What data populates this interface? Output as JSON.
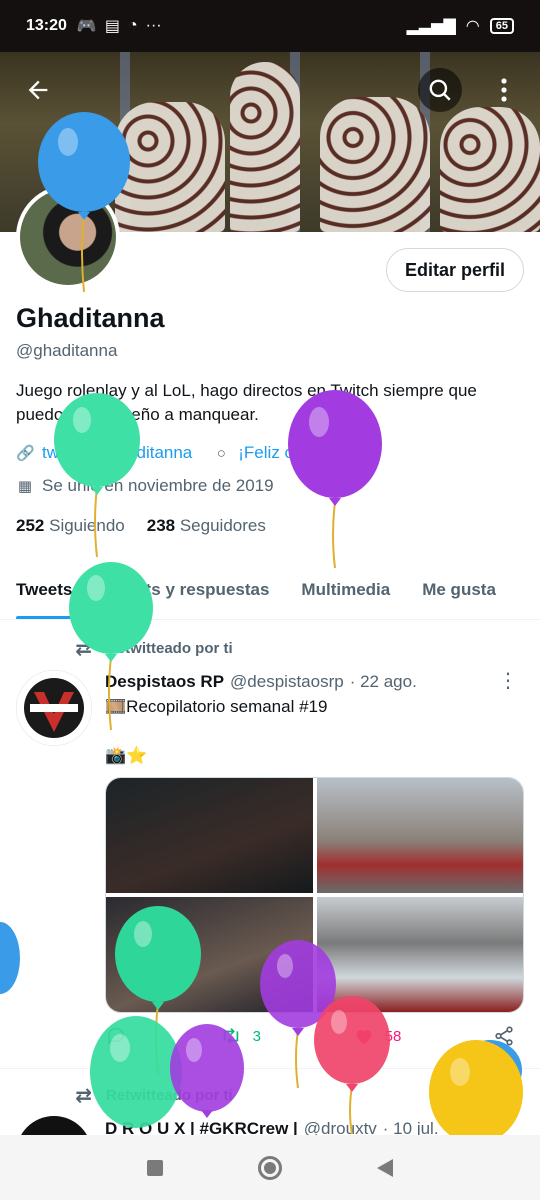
{
  "status_bar": {
    "time": "13:20",
    "more": "···",
    "battery": "65"
  },
  "profile": {
    "name": "Ghaditanna",
    "handle": "@ghaditanna",
    "bio": "Juego roleplay y al LoL, hago directos en Twitch siempre que puedo y os enseño a manquear.",
    "link": "twitch.tv/ghaditanna",
    "birthday": "¡Feliz cumpleaños!",
    "joined": "Se unió en noviembre de 2019",
    "following_count": "252",
    "following_label": "Siguiendo",
    "followers_count": "238",
    "followers_label": "Seguidores",
    "edit_label": "Editar perfil"
  },
  "tabs": [
    {
      "label": "Tweets"
    },
    {
      "label": "Tweets y respuestas"
    },
    {
      "label": "Multimedia"
    },
    {
      "label": "Me gusta"
    }
  ],
  "tweets": [
    {
      "retweet_label": "Retwitteado por ti",
      "author": "Despistaos RP",
      "handle": "@despistaosrp",
      "date": "· 22 ago.",
      "line1": "🎞️Recopilatorio semanal #19",
      "line2": "📸⭐",
      "replies": "",
      "retweets": "3",
      "likes": "58"
    },
    {
      "retweet_label": "Retwitteado por ti",
      "author": "D R O U X | #GKRCrew |",
      "handle": "@drouxtv",
      "date": "· 10 jul."
    }
  ],
  "colors": {
    "accent": "#1d9bf0",
    "retweet": "#00ba7c",
    "like": "#f91880"
  },
  "icons": {
    "back": "arrow-left-icon",
    "search": "search-icon",
    "more": "more-vertical-icon",
    "link": "link-icon",
    "birthday": "balloon-icon",
    "calendar": "calendar-icon",
    "retweet": "retweet-icon",
    "reply": "reply-icon",
    "like": "heart-icon",
    "share": "share-icon"
  }
}
